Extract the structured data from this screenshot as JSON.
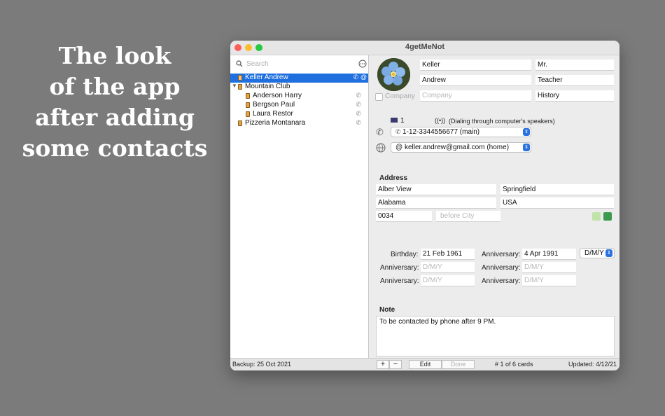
{
  "promo": {
    "line1": "The look",
    "line2": "of the app",
    "line3": "after adding",
    "line4": "some contacts"
  },
  "window": {
    "title": "4getMeNot"
  },
  "colors": {
    "accent": "#1f6fde",
    "close": "#fe5f57",
    "minimize": "#febc2e",
    "zoom": "#28c840"
  },
  "sidebar": {
    "search_placeholder": "Search",
    "items": [
      {
        "label": "Keller Andrew",
        "selected": true
      },
      {
        "label": "Mountain Club",
        "group": true
      },
      {
        "label": "Anderson Harry"
      },
      {
        "label": "Bergson Paul"
      },
      {
        "label": "Laura Restor"
      },
      {
        "label": "Pizzeria Montanara"
      }
    ],
    "backup": "Backup: 25 Oct 2021"
  },
  "contact": {
    "last_name": "Keller",
    "title": "Mr.",
    "first_name": "Andrew",
    "job": "Teacher",
    "company_label": "Company",
    "company_placeholder": "Company",
    "department": "History",
    "country_code": "1",
    "dialing": "(Dialing through computer's speakers)",
    "phone": "1-12-3344556677 (main)",
    "email": "keller.andrew@gmail.com (home)"
  },
  "address": {
    "heading": "Address",
    "street": "Alber View",
    "city": "Springfield",
    "state": "Alabama",
    "country": "USA",
    "zip": "0034",
    "before_city_placeholder": "before City"
  },
  "dates": {
    "birthday_label": "Birthday:",
    "birthday": "21 Feb 1961",
    "anniversary_label": "Anniversary:",
    "anniversary1": "4 Apr 1991",
    "format": "D/M/Y",
    "placeholder": "D/M/Y"
  },
  "note": {
    "heading": "Note",
    "text": "To be contacted by phone after 9 PM."
  },
  "bottom": {
    "add": "+",
    "remove": "−",
    "edit": "Edit",
    "done": "Done",
    "count": "# 1 of 6 cards",
    "updated": "Updated: 4/12/21"
  }
}
